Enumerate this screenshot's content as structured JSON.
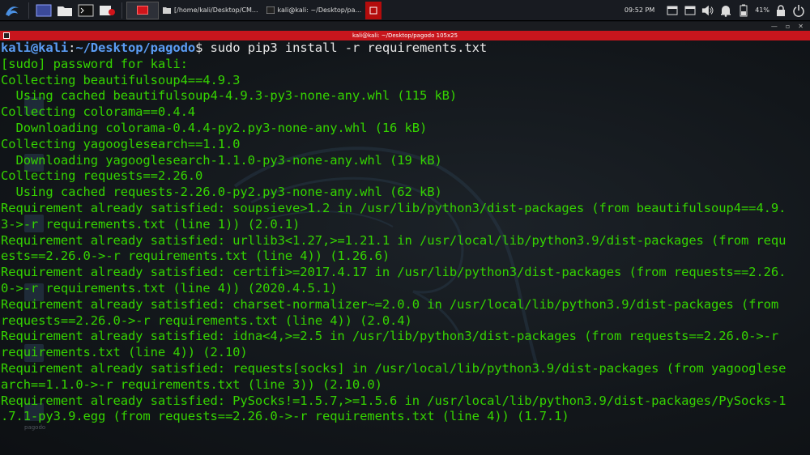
{
  "taskbar": {
    "tasks": [
      {
        "label": "[/home/kali/Desktop/CM..."
      },
      {
        "label": "kali@kali: ~/Desktop/pa..."
      }
    ],
    "clock": "09:52 PM",
    "battery": "41%"
  },
  "window": {
    "title": "kali@kali: ~/Desktop/pagodo 105x25"
  },
  "desktop": {
    "icon_label": "pagodo"
  },
  "prompt": {
    "user": "kali",
    "host": "kali",
    "path": "~/Desktop/pagodo",
    "command": "sudo pip3 install -r requirements.txt"
  },
  "output": [
    "[sudo] password for kali:",
    "Collecting beautifulsoup4==4.9.3",
    "  Using cached beautifulsoup4-4.9.3-py3-none-any.whl (115 kB)",
    "Collecting colorama==0.4.4",
    "  Downloading colorama-0.4.4-py2.py3-none-any.whl (16 kB)",
    "Collecting yagooglesearch==1.1.0",
    "  Downloading yagooglesearch-1.1.0-py3-none-any.whl (19 kB)",
    "Collecting requests==2.26.0",
    "  Using cached requests-2.26.0-py2.py3-none-any.whl (62 kB)",
    "Requirement already satisfied: soupsieve>1.2 in /usr/lib/python3/dist-packages (from beautifulsoup4==4.9.",
    "3->-r requirements.txt (line 1)) (2.0.1)",
    "Requirement already satisfied: urllib3<1.27,>=1.21.1 in /usr/local/lib/python3.9/dist-packages (from requ",
    "ests==2.26.0->-r requirements.txt (line 4)) (1.26.6)",
    "Requirement already satisfied: certifi>=2017.4.17 in /usr/lib/python3/dist-packages (from requests==2.26.",
    "0->-r requirements.txt (line 4)) (2020.4.5.1)",
    "Requirement already satisfied: charset-normalizer~=2.0.0 in /usr/local/lib/python3.9/dist-packages (from",
    "requests==2.26.0->-r requirements.txt (line 4)) (2.0.4)",
    "Requirement already satisfied: idna<4,>=2.5 in /usr/lib/python3/dist-packages (from requests==2.26.0->-r",
    "requirements.txt (line 4)) (2.10)",
    "Requirement already satisfied: requests[socks] in /usr/local/lib/python3.9/dist-packages (from yagooglese",
    "arch==1.1.0->-r requirements.txt (line 3)) (2.10.0)",
    "Requirement already satisfied: PySocks!=1.5.7,>=1.5.6 in /usr/local/lib/python3.9/dist-packages/PySocks-1",
    ".7.1-py3.9.egg (from requests==2.26.0->-r requirements.txt (line 4)) (1.7.1)"
  ],
  "colors": {
    "output_text": "#35d400",
    "prompt_blue": "#5b9df5",
    "title_red": "#c8161d"
  }
}
